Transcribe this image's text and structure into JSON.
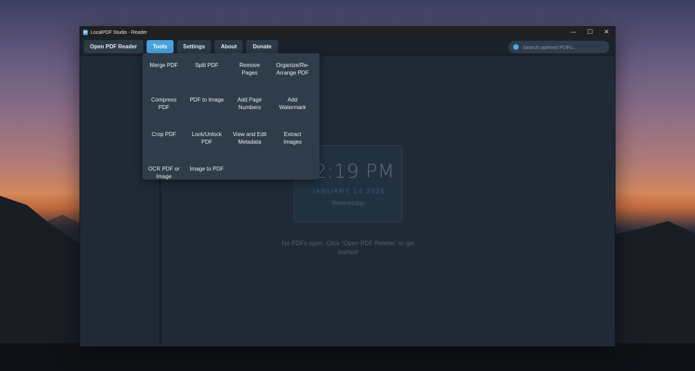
{
  "window": {
    "title": "LocalPDF Studio - Reader",
    "controls": [
      "—",
      "☐",
      "✕"
    ]
  },
  "toolbar": {
    "buttons": [
      {
        "label": "Open PDF Reader",
        "active": false
      },
      {
        "label": "Tools",
        "active": true
      },
      {
        "label": "Settings",
        "active": false
      },
      {
        "label": "About",
        "active": false
      },
      {
        "label": "Donate",
        "active": false
      }
    ],
    "search_placeholder": "Search opened PDFs..."
  },
  "tools_menu": {
    "items": [
      "Merge PDF",
      "Split PDF",
      "Remove Pages",
      "Organize/Re-Arrange PDF",
      "Compress PDF",
      "PDF to Image",
      "Add Page Numbers",
      "Add Watermark",
      "Crop PDF",
      "Lock/Unlock PDF",
      "View and Edit Metadata",
      "Extract Images",
      "OCR PDF or Image",
      "Image to PDF"
    ]
  },
  "clock": {
    "time": "12:19 PM",
    "date": "JANUARY 14 2026",
    "day": "Wednesday"
  },
  "empty_message": "No PDFs open. Click \"Open PDF Reader\" to get started!",
  "colors": {
    "accent": "#4aa3df",
    "window_bg": "#1f2a36",
    "menu_bg": "#2f3c4a"
  }
}
